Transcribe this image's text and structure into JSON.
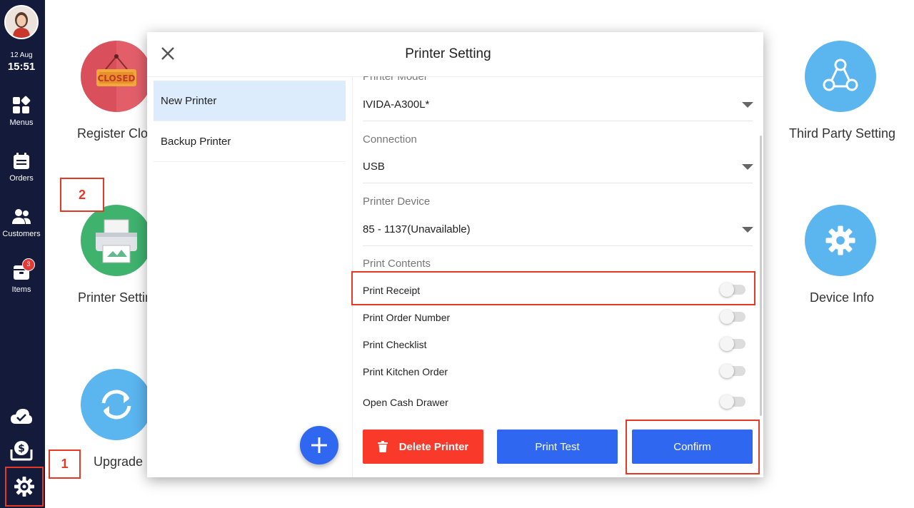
{
  "sidebar": {
    "date": "12 Aug",
    "time": "15:51",
    "items": [
      {
        "label": "Menus"
      },
      {
        "label": "Orders"
      },
      {
        "label": "Customers"
      },
      {
        "label": "Items",
        "badge": "3"
      }
    ]
  },
  "tiles": {
    "register_closed": "Register Clos",
    "closed_sign": "CLOSED",
    "printer_setting": "Printer Settin",
    "upgrade": "Upgrade",
    "third_party": "Third Party Setting",
    "device_info": "Device Info"
  },
  "steps": {
    "one": "1",
    "two": "2"
  },
  "modal": {
    "title": "Printer Setting",
    "printers": [
      "New Printer",
      "Backup Printer"
    ],
    "fields": {
      "model_label": "Printer Model",
      "model_value": "IVIDA-A300L*",
      "connection_label": "Connection",
      "connection_value": "USB",
      "device_label": "Printer Device",
      "device_value": "85 - 1137(Unavailable)",
      "contents_label": "Print Contents"
    },
    "toggles": [
      {
        "label": "Print Receipt",
        "on": false
      },
      {
        "label": "Print Order Number",
        "on": false
      },
      {
        "label": "Print Checklist",
        "on": false
      },
      {
        "label": "Print Kitchen Order",
        "on": false
      },
      {
        "label": "Open Cash Drawer",
        "on": false
      }
    ],
    "buttons": {
      "delete": "Delete Printer",
      "test": "Print Test",
      "confirm": "Confirm"
    }
  },
  "colors": {
    "sidebar": "#141a3a",
    "accent_blue": "#2f67f0",
    "danger_red": "#f93a2a",
    "highlight_red": "#e53925",
    "selected_row": "#dcecfc"
  }
}
